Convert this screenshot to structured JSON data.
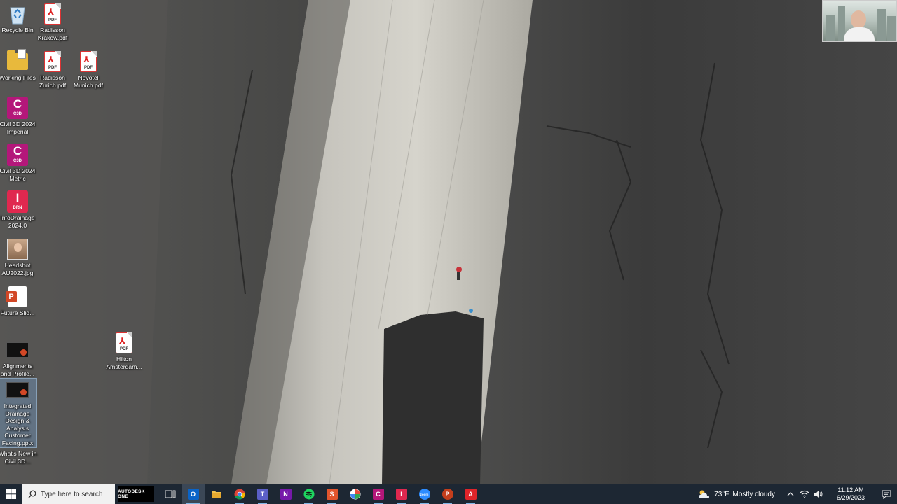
{
  "desktop": {
    "icons": [
      {
        "id": "recycle-bin",
        "label": "Recycle Bin"
      },
      {
        "id": "pdf-krakow",
        "label": "Radisson Krakow.pdf"
      },
      {
        "id": "working-files",
        "label": "Working Files"
      },
      {
        "id": "pdf-zurich",
        "label": "Radisson Zurich.pdf"
      },
      {
        "id": "pdf-munich",
        "label": "Novotel Munich.pdf"
      },
      {
        "id": "civil3d-imperial",
        "label": "Civil 3D 2024 Imperial",
        "badge_letter": "C",
        "badge_text": "C3D"
      },
      {
        "id": "civil3d-metric",
        "label": "Civil 3D 2024 Metric",
        "badge_letter": "C",
        "badge_text": "C3D"
      },
      {
        "id": "infodrainage",
        "label": "InfoDrainage 2024.0",
        "badge_letter": "I",
        "badge_text": "DRN"
      },
      {
        "id": "headshot",
        "label": "Headshot AU2022.jpg"
      },
      {
        "id": "future-slides",
        "label": "Future Slid..."
      },
      {
        "id": "alignments",
        "label": "Alignments and Profile..."
      },
      {
        "id": "pdf-hilton",
        "label": "Hilton Amsterdam..."
      },
      {
        "id": "integrated-drainage",
        "label": "Integrated Drainage Design & Analysis Customer Facing.pptx"
      },
      {
        "id": "whats-new",
        "label": "What's New in Civil 3D..."
      }
    ],
    "pdf_tag": "PDF"
  },
  "taskbar": {
    "search_placeholder": "Type here to search",
    "autodesk_one_label": "AUTODESK ONE",
    "apps": [
      {
        "id": "task-view",
        "icon": "task-view-icon"
      },
      {
        "id": "outlook",
        "icon": "outlook-icon",
        "letter": "O",
        "color": "#0a64c8"
      },
      {
        "id": "file-explorer",
        "icon": "folder-icon"
      },
      {
        "id": "chrome",
        "icon": "chrome-icon"
      },
      {
        "id": "teams",
        "icon": "teams-icon",
        "letter": "T",
        "color": "#5b5fc7"
      },
      {
        "id": "onenote",
        "icon": "onenote-icon",
        "letter": "N",
        "color": "#7719aa"
      },
      {
        "id": "spotify",
        "icon": "spotify-icon"
      },
      {
        "id": "snagit",
        "icon": "snagit-icon",
        "letter": "S",
        "color": "#e2552d"
      },
      {
        "id": "app-globe",
        "icon": "globe-app-icon"
      },
      {
        "id": "civil3d",
        "icon": "civil3d-icon",
        "letter": "C",
        "color": "#b4177a"
      },
      {
        "id": "infodrainage",
        "icon": "infodrainage-icon",
        "letter": "I",
        "color": "#e0284f"
      },
      {
        "id": "zoom",
        "icon": "zoom-icon",
        "letter": "zoom",
        "color": "#2d8cff"
      },
      {
        "id": "powerpoint",
        "icon": "powerpoint-icon",
        "letter": "P",
        "color": "#c43e1c"
      },
      {
        "id": "acrobat",
        "icon": "acrobat-icon",
        "letter": "A",
        "color": "#e0242a"
      }
    ],
    "weather": {
      "temp": "73°F",
      "condition": "Mostly cloudy"
    },
    "clock": {
      "time": "11:12 AM",
      "date": "6/29/2023"
    }
  },
  "colors": {
    "taskbar_bg": "#1d2733",
    "accent": "#7fb6e6"
  }
}
